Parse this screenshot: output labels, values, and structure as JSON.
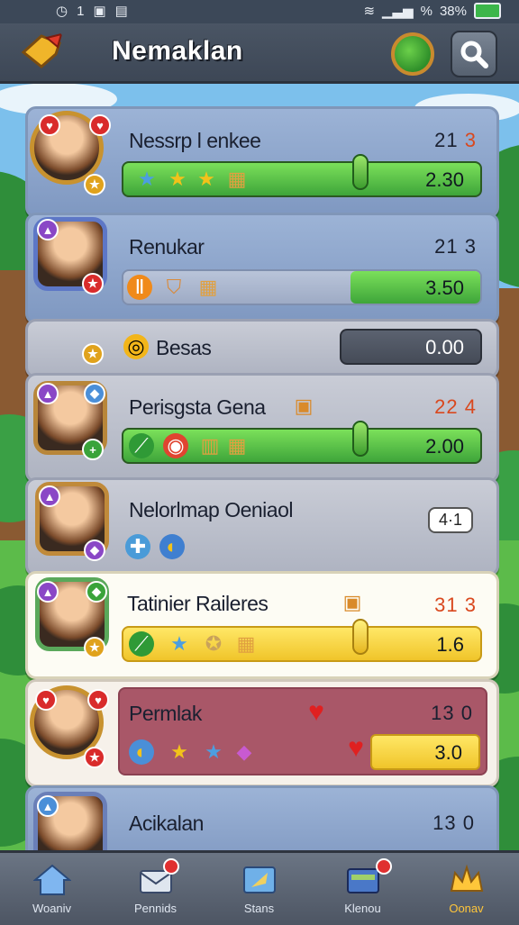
{
  "status_bar": {
    "left_text": "1",
    "signal_text": "%",
    "battery_text": "38%"
  },
  "header": {
    "title": "Nemaklan"
  },
  "rows": [
    {
      "name": "Nessrp l enkee",
      "rank": "21",
      "rank_hl": "3",
      "score": "2.30"
    },
    {
      "name": "Renukar",
      "rank": "21 3",
      "rank_hl": "",
      "score": "3.50"
    },
    {
      "name": "Besas",
      "rank": "",
      "rank_hl": "",
      "score": "0.00"
    },
    {
      "name": "Perisgsta Gena",
      "rank": "",
      "rank_hl": "22 4",
      "score": "2.00"
    },
    {
      "name": "Nelorlmap Oeniaol",
      "pill": "4·1"
    },
    {
      "name": "Tatinier Raileres",
      "rank": "",
      "rank_hl": "31 3",
      "score": "1.6"
    },
    {
      "name": "Permlak",
      "rank": "13 0",
      "rank_hl": "",
      "score": "3.0"
    },
    {
      "name": "Acikalan",
      "rank": "13 0",
      "rank_hl": ""
    }
  ],
  "nav": [
    {
      "label": "Woaniv",
      "icon": "home-icon"
    },
    {
      "label": "Pennids",
      "icon": "mail-icon"
    },
    {
      "label": "Stans",
      "icon": "map-icon"
    },
    {
      "label": "Klenou",
      "icon": "shop-icon"
    },
    {
      "label": "Oonav",
      "icon": "crown-icon"
    }
  ],
  "colors": {
    "accent_green": "#3ea53a",
    "header": "#3d4756",
    "active_nav": "#ffc63a"
  }
}
